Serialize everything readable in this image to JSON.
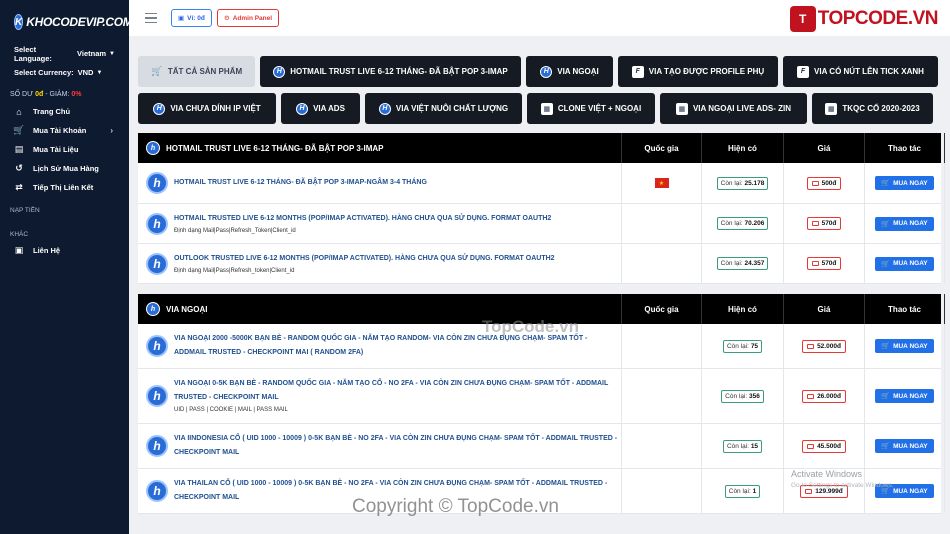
{
  "sidebar": {
    "logo_text": "KHOCODEVIP.COM",
    "language_label": "Select Language:",
    "language_value": "Vietnam",
    "currency_label": "Select Currency:",
    "currency_value": "VND",
    "balance_label": "SỐ DƯ",
    "balance_value": "0đ",
    "discount_label": "- GIẢM:",
    "discount_value": "0%",
    "nav": [
      {
        "label": "Trang Chủ",
        "icon": "home-icon"
      },
      {
        "label": "Mua Tài Khoản",
        "icon": "cart-icon",
        "has_submenu": true
      },
      {
        "label": "Mua Tài Liệu",
        "icon": "document-icon"
      },
      {
        "label": "Lịch Sử Mua Hàng",
        "icon": "history-icon"
      },
      {
        "label": "Tiếp Thị Liên Kết",
        "icon": "share-icon"
      }
    ],
    "section_topup": "NẠP TIỀN",
    "section_other": "KHÁC",
    "contact_label": "Liên Hệ"
  },
  "topbar": {
    "wallet_label": "Ví: 0đ",
    "admin_label": "Admin Panel",
    "brand_text": "TOPCODE.VN",
    "brand_mark": "T"
  },
  "categories": [
    {
      "label": "TẤT CẢ SẢN PHẨM",
      "active": true
    },
    {
      "label": "HOTMAIL TRUST LIVE 6-12 THÁNG- ĐÃ BẬT POP 3-IMAP"
    },
    {
      "label": "VIA NGOẠI"
    },
    {
      "label": "VIA TẠO ĐƯỢC PROFILE PHỤ"
    },
    {
      "label": "VIA CÓ NÚT LÊN TICK XANH"
    },
    {
      "label": "VIA CHƯA DÍNH IP VIỆT"
    },
    {
      "label": "VIA ADS"
    },
    {
      "label": "VIA VIỆT NUÔI CHẤT LƯỢNG"
    },
    {
      "label": "CLONE VIỆT + NGOẠI"
    },
    {
      "label": "VIA NGOẠI LIVE ADS- ZIN"
    },
    {
      "label": "TKQC CỔ 2020-2023"
    }
  ],
  "table_headers": {
    "country": "Quốc gia",
    "stock": "Hiện có",
    "price": "Giá",
    "action": "Thao tác"
  },
  "stock_prefix": "Còn lại:",
  "buy_label": "MUA NGAY",
  "groups": [
    {
      "title": "HOTMAIL TRUST LIVE 6-12 THÁNG- ĐÃ BẬT POP 3-IMAP",
      "rows": [
        {
          "title": "HOTMAIL TRUST LIVE 6-12 THÁNG- ĐÃ BẬT POP 3-IMAP-NGÂM 3-4 THÁNG",
          "sub": "",
          "stock": "25.178",
          "price": "500đ",
          "flag": true
        },
        {
          "title": "HOTMAIL TRUSTED LIVE 6-12 MONTHS (POP/IMAP ACTIVATED). HÀNG CHƯA QUA SỬ DỤNG. FORMAT OAUTH2",
          "sub": "Định dạng Mail|Pass|Refresh_Token|Client_id",
          "stock": "70.206",
          "price": "570đ",
          "flag": false
        },
        {
          "title": "OUTLOOK TRUSTED LIVE 6-12 MONTHS (POP/IMAP ACTIVATED). HÀNG CHƯA QUA SỬ DỤNG. FORMAT OAUTH2",
          "sub": "Định dạng Mail|Pass|Refresh_token|Client_id",
          "stock": "24.357",
          "price": "570đ",
          "flag": false
        }
      ]
    },
    {
      "title": "VIA NGOẠI",
      "rows": [
        {
          "title": "VIA NGOẠI 2000 -5000k BẠN BÈ - RANDOM QUỐC GIA - NĂM TẠO RANDOM- VIA CÒN ZIN CHƯA ĐỤNG CHẠM- SPAM TỐT - ADDMAIL TRUSTED - CHECKPOINT MAI ( RANDOM 2FA)",
          "sub": "",
          "stock": "75",
          "price": "52.000đ",
          "flag": false
        },
        {
          "title": "VIA NGOẠI 0-5k BẠN BÈ - RANDOM QUỐC GIA - NĂM TẠO CỔ - NO 2FA - VIA CÒN ZIN CHƯA ĐỤNG CHẠM- SPAM TỐT - ADDMAIL TRUSTED - CHECKPOINT MAIL",
          "sub": "UID | PASS | COOKIE | MAIL | PASS MAIL",
          "stock": "356",
          "price": "26.000đ",
          "flag": false
        },
        {
          "title": "VIA iINDONESIA Cổ ( UID 1000 - 10009 ) 0-5k BẠN BÈ - NO 2FA - VIA CÒN ZIN CHƯA ĐỤNG CHẠM- SPAM TỐT - ADDMAIL TRUSTED - CHECKPOINT MAIL",
          "sub": "",
          "stock": "15",
          "price": "45.500đ",
          "flag": false
        },
        {
          "title": "VIA THAILAN Cổ ( UID 1000 - 10009 ) 0-5k BẠN BÈ - NO 2FA - VIA CÒN ZIN CHƯA ĐỤNG CHẠM- SPAM TỐT - ADDMAIL TRUSTED - CHECKPOINT MAIL",
          "sub": "",
          "stock": "1",
          "price": "129.999đ",
          "flag": false
        }
      ]
    }
  ],
  "watermarks": {
    "activate_title": "Activate Windows",
    "activate_sub": "Go to Settings to activate Windows.",
    "center": "TopCode.vn",
    "copyright": "Copyright © TopCode.vn"
  }
}
